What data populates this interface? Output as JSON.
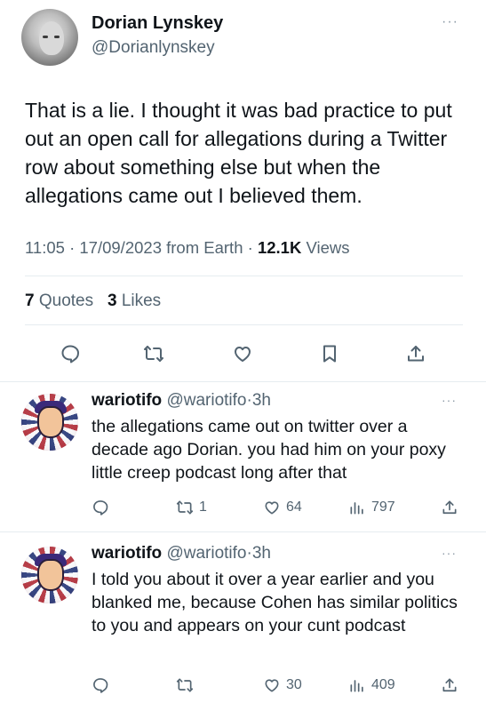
{
  "main_tweet": {
    "author_name": "Dorian Lynskey",
    "author_handle": "@Dorianlynskey",
    "more_label": "···",
    "text": "That is a lie. I thought it was bad practice to put out an open call for allegations during a Twitter row about something else but when the allegations came out I believed them.",
    "time": "11:05",
    "date": "17/09/2023",
    "source": "from Earth",
    "views_count": "12.1K",
    "views_label": "Views",
    "quotes_count": "7",
    "quotes_label": "Quotes",
    "likes_count": "3",
    "likes_label": "Likes",
    "actions": [
      "reply-icon",
      "retweet-icon",
      "like-icon",
      "bookmark-icon",
      "share-icon"
    ]
  },
  "replies": [
    {
      "author_name": "wariotifo",
      "author_handle": "@wariotifo",
      "age": "3h",
      "more_label": "···",
      "text": "the allegations came out on twitter over a decade ago Dorian. you had him on your poxy little creep podcast long after that",
      "retweets": "1",
      "likes": "64",
      "views": "797"
    },
    {
      "author_name": "wariotifo",
      "author_handle": "@wariotifo",
      "age": "3h",
      "more_label": "···",
      "text": "I told you about it over a year earlier and you blanked me, because Cohen has similar politics to you and appears on your cunt podcast",
      "retweets": "",
      "likes": "30",
      "views": "409"
    }
  ],
  "separator": "·",
  "colors": {
    "text_primary": "#0f1419",
    "text_secondary": "#536471",
    "divider": "#e6ecf0",
    "background": "#ffffff"
  }
}
